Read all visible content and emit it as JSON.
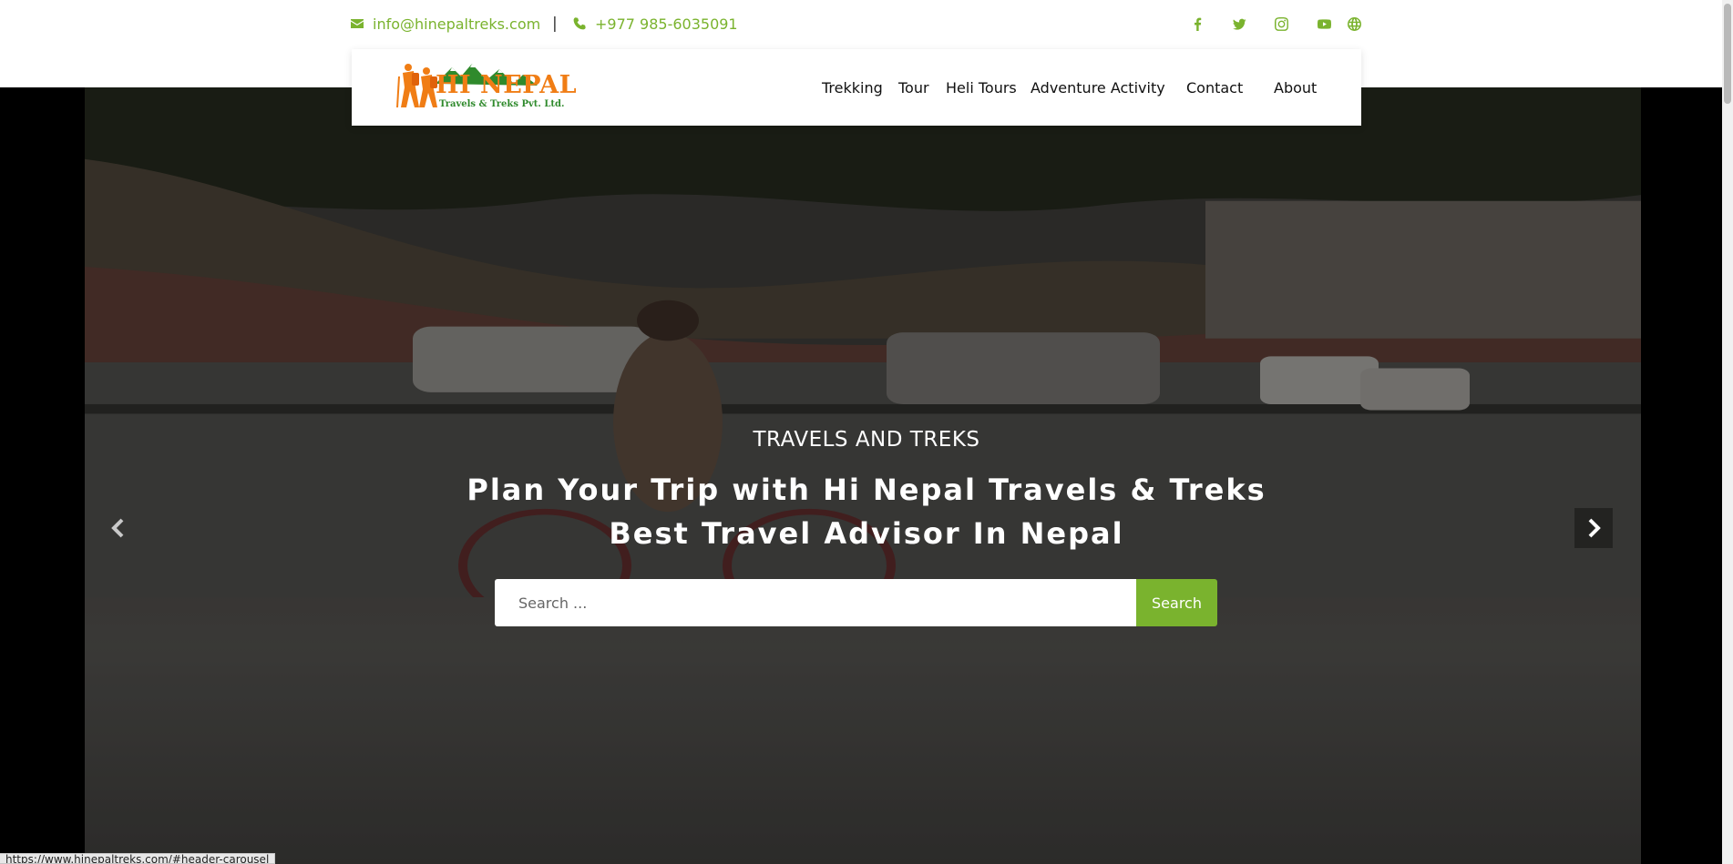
{
  "colors": {
    "accent": "#7ab32e",
    "logo_orange": "#f07d15",
    "logo_green": "#2f8a2c"
  },
  "topbar": {
    "email": "info@hinepaltreks.com",
    "separator": "|",
    "phone": "+977 985-6035091",
    "social_icons": [
      "facebook-icon",
      "twitter-icon",
      "instagram-icon",
      "youtube-icon",
      "globe-icon"
    ]
  },
  "logo": {
    "title": "HI NEPAL",
    "subtitle": "Travels & Treks Pvt. Ltd."
  },
  "nav": {
    "items": [
      {
        "label": "Trekking"
      },
      {
        "label": "Tour"
      },
      {
        "label": "Heli Tours"
      },
      {
        "label": "Adventure Activity"
      },
      {
        "label": "Contact"
      },
      {
        "label": "About"
      }
    ]
  },
  "hero": {
    "kicker": "TRAVELS AND TREKS",
    "title_line1": "Plan Your Trip with Hi Nepal Travels & Treks",
    "title_line2": "Best Travel Advisor In Nepal",
    "search_placeholder": "Search ...",
    "search_button": "Search"
  },
  "status_bar": {
    "url": "https://www.hinepaltreks.com/#header-carousel"
  }
}
